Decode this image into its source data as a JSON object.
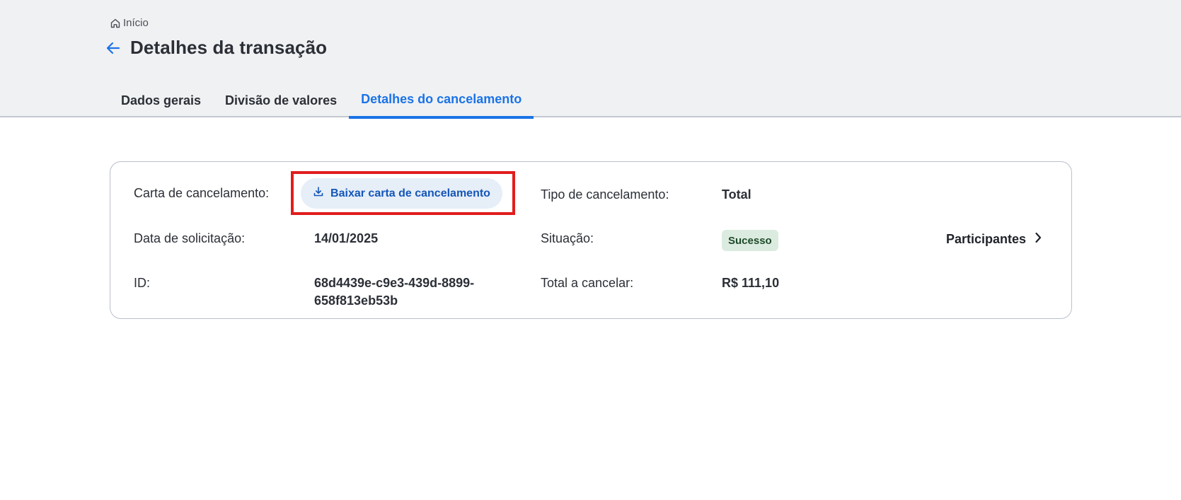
{
  "breadcrumb": {
    "home_label": "Início"
  },
  "page_title": "Detalhes da transação",
  "tabs": [
    {
      "label": "Dados gerais",
      "active": false
    },
    {
      "label": "Divisão de valores",
      "active": false
    },
    {
      "label": "Detalhes do cancelamento",
      "active": true
    }
  ],
  "details": {
    "letter_label": "Carta de cancelamento:",
    "download_button_label": "Baixar carta de cancelamento",
    "type_label": "Tipo de cancelamento:",
    "type_value": "Total",
    "request_date_label": "Data de solicitação:",
    "request_date_value": "14/01/2025",
    "status_label": "Situação:",
    "status_value": "Sucesso",
    "participants_label": "Participantes",
    "id_label": "ID:",
    "id_value_line1": "68d4439e-c9e3-439d-8899-",
    "id_value_line2": "658f813eb53b",
    "total_label": "Total a cancelar:",
    "total_value": "R$ 111,10"
  },
  "colors": {
    "accent": "#1a73e8",
    "header_bg": "#f0f1f3",
    "highlight": "#e11d1d",
    "success_bg": "#dcebe0"
  }
}
